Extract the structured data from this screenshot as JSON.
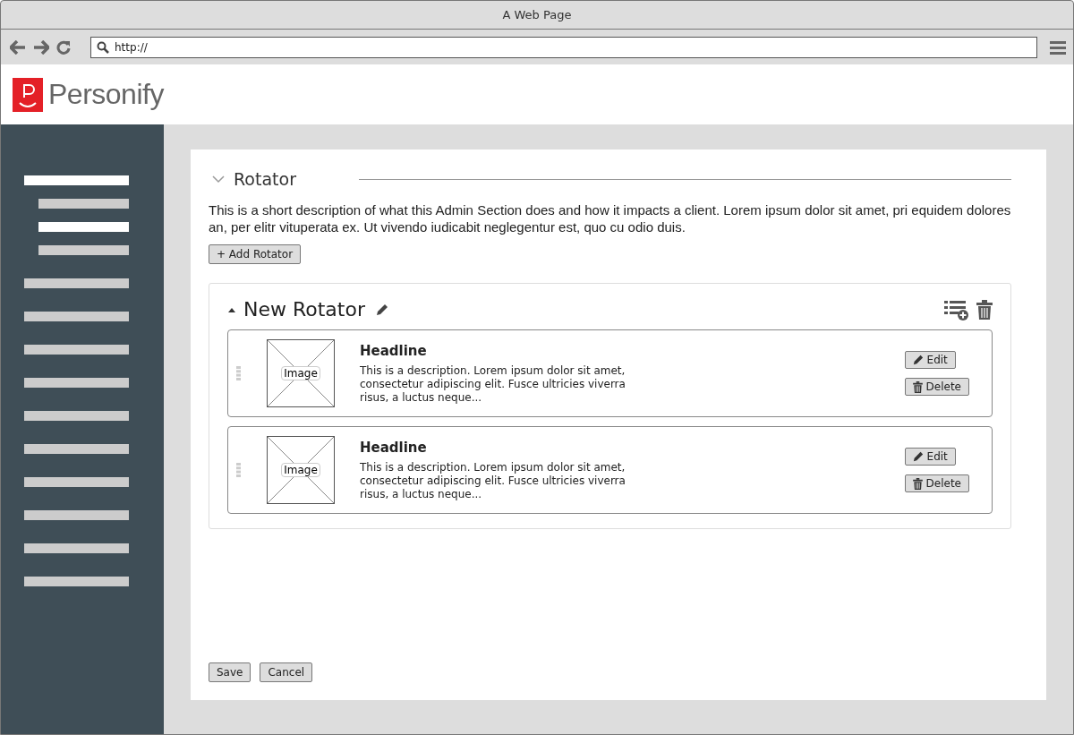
{
  "window": {
    "title": "A Web Page"
  },
  "address_bar": {
    "value": "http://"
  },
  "logo": {
    "text": "Personify"
  },
  "sidebar": {
    "items": [
      {
        "selected": true,
        "children": [
          {
            "selected": false
          },
          {
            "selected": true
          },
          {
            "selected": false
          }
        ]
      },
      {
        "selected": false
      },
      {
        "selected": false
      },
      {
        "selected": false
      },
      {
        "selected": false
      },
      {
        "selected": false
      },
      {
        "selected": false
      },
      {
        "selected": false
      },
      {
        "selected": false
      },
      {
        "selected": false
      },
      {
        "selected": false
      }
    ]
  },
  "section": {
    "title": "Rotator",
    "expanded": true,
    "description": "This is a short description of what this Admin Section does and how it impacts a client. Lorem ipsum dolor sit amet, pri equidem dolores an, per elitr vituperata ex. Ut vivendo iudicabit neglegentur est, quo cu odio duis.",
    "add_button": "+ Add Rotator",
    "rotator": {
      "title": "New Rotator",
      "expanded": true,
      "slides": [
        {
          "image_label": "Image",
          "headline": "Headline",
          "description": "This is a description. Lorem ipsum dolor sit amet, consectetur adipiscing elit. Fusce ultricies viverra risus, a luctus neque...",
          "edit": "Edit",
          "delete": "Delete"
        },
        {
          "image_label": "Image",
          "headline": "Headline",
          "description": "This is a description. Lorem ipsum dolor sit amet, consectetur adipiscing elit. Fusce ultricies viverra risus, a luctus neque...",
          "edit": "Edit",
          "delete": "Delete"
        }
      ]
    }
  },
  "buttons": [
    "Save",
    "Cancel"
  ]
}
